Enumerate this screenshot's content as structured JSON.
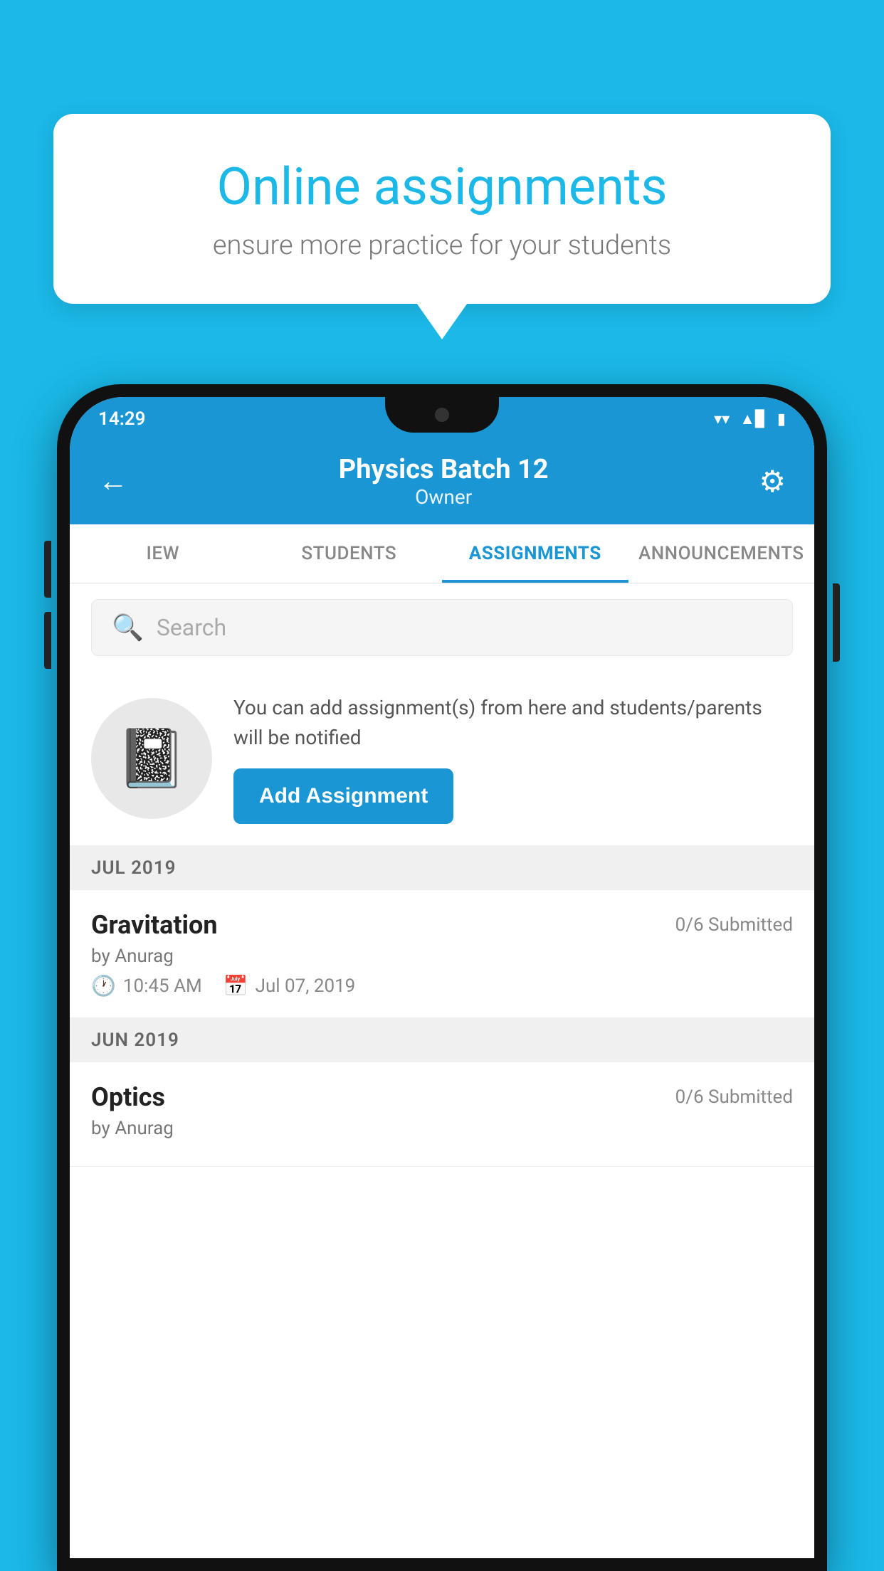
{
  "background_color": "#1BB8E8",
  "speech_bubble": {
    "title": "Online assignments",
    "subtitle": "ensure more practice for your students"
  },
  "phone": {
    "status_bar": {
      "time": "14:29",
      "wifi": "▼",
      "signal": "▲",
      "battery": "▮"
    },
    "header": {
      "title": "Physics Batch 12",
      "subtitle": "Owner",
      "back_label": "←",
      "settings_label": "⚙"
    },
    "tabs": [
      {
        "label": "IEW",
        "active": false
      },
      {
        "label": "STUDENTS",
        "active": false
      },
      {
        "label": "ASSIGNMENTS",
        "active": true
      },
      {
        "label": "ANNOUNCEMENTS",
        "active": false
      }
    ],
    "search": {
      "placeholder": "Search"
    },
    "promo": {
      "text": "You can add assignment(s) from here and students/parents will be notified",
      "button_label": "Add Assignment"
    },
    "sections": [
      {
        "month_label": "JUL 2019",
        "assignments": [
          {
            "name": "Gravitation",
            "submitted": "0/6 Submitted",
            "by": "by Anurag",
            "time": "10:45 AM",
            "date": "Jul 07, 2019"
          }
        ]
      },
      {
        "month_label": "JUN 2019",
        "assignments": [
          {
            "name": "Optics",
            "submitted": "0/6 Submitted",
            "by": "by Anurag",
            "time": "",
            "date": ""
          }
        ]
      }
    ]
  }
}
